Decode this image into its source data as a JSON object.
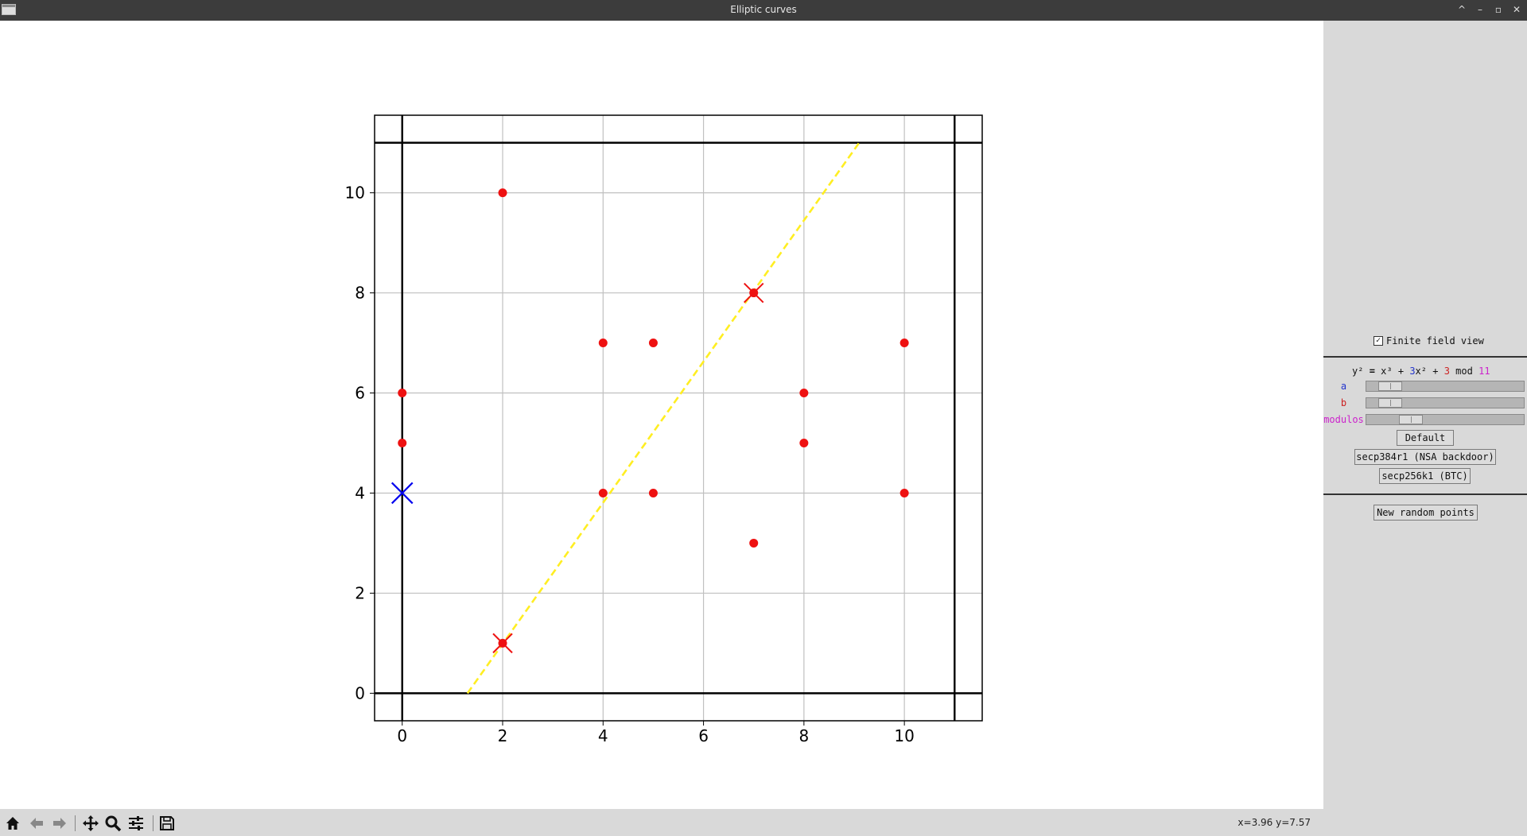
{
  "window": {
    "title": "Elliptic curves",
    "controls": {
      "minimize": "–",
      "maximize": "▫",
      "close": "✕",
      "shade": "^"
    }
  },
  "chart_data": {
    "type": "scatter",
    "xlim": [
      -0.55,
      11.55
    ],
    "ylim": [
      -0.55,
      11.55
    ],
    "xticks": [
      0,
      2,
      4,
      6,
      8,
      10
    ],
    "yticks": [
      0,
      2,
      4,
      6,
      8,
      10
    ],
    "grid": true,
    "curve_points": [
      [
        0,
        5
      ],
      [
        0,
        6
      ],
      [
        2,
        10
      ],
      [
        4,
        4
      ],
      [
        4,
        7
      ],
      [
        5,
        4
      ],
      [
        5,
        7
      ],
      [
        7,
        3
      ],
      [
        8,
        5
      ],
      [
        8,
        6
      ],
      [
        10,
        4
      ],
      [
        10,
        7
      ],
      [
        2,
        1
      ],
      [
        7,
        8
      ]
    ],
    "selected_points": [
      [
        2,
        1
      ],
      [
        7,
        8
      ]
    ],
    "marked_point": [
      0,
      4
    ],
    "field_boundary_lines": {
      "x": [
        0,
        11
      ],
      "y": [
        0,
        11
      ]
    },
    "secant_line": {
      "from": [
        1.3,
        0
      ],
      "to": [
        9.1,
        11
      ]
    },
    "colors": {
      "points": "#ee1111",
      "marked": "#0000ee",
      "line": "#ffee22",
      "grid": "#c0c0c0"
    }
  },
  "panel": {
    "finite_field_label": "Finite field view",
    "finite_field_checked": true,
    "equation": {
      "lhs": "y²",
      "eq": "=",
      "x3": "x³",
      "plus1": "+",
      "a": "3",
      "x2": "x²",
      "plus2": "+",
      "b": "3",
      "mod": "mod",
      "p": "11"
    },
    "sliders": [
      {
        "label": "a",
        "color": "#2233cc",
        "position": 0.09
      },
      {
        "label": "b",
        "color": "#cc2222",
        "position": 0.09
      },
      {
        "label": "modulos",
        "color": "#cc22cc",
        "position": 0.24
      }
    ],
    "buttons": {
      "default": "Default",
      "secp384": "secp384r1 (NSA backdoor)",
      "secp256": "secp256k1 (BTC)",
      "random": "New random points"
    }
  },
  "toolbar": {
    "icons": [
      "home-icon",
      "back-icon",
      "forward-icon",
      "pan-icon",
      "zoom-icon",
      "configure-icon",
      "save-icon"
    ],
    "coordinates": "x=3.96 y=7.57"
  }
}
